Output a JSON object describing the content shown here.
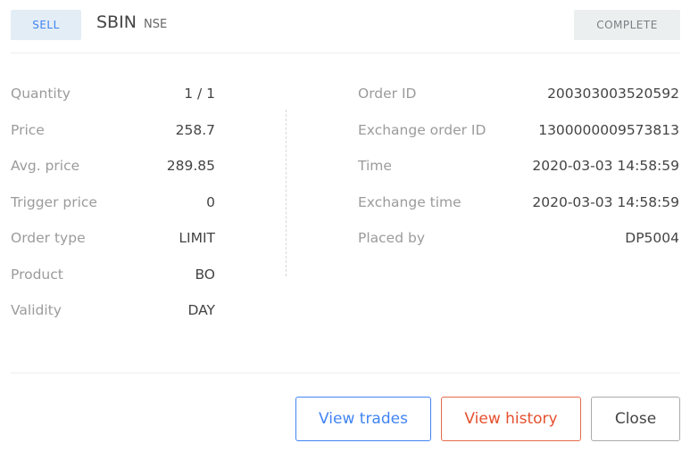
{
  "header": {
    "side": "SELL",
    "symbol": "SBIN",
    "exchange": "NSE",
    "status": "COMPLETE"
  },
  "details_left": [
    {
      "label": "Quantity",
      "value": "1 / 1"
    },
    {
      "label": "Price",
      "value": "258.7"
    },
    {
      "label": "Avg. price",
      "value": "289.85"
    },
    {
      "label": "Trigger price",
      "value": "0"
    },
    {
      "label": "Order type",
      "value": "LIMIT"
    },
    {
      "label": "Product",
      "value": "BO"
    },
    {
      "label": "Validity",
      "value": "DAY"
    }
  ],
  "details_right": [
    {
      "label": "Order ID",
      "value": "200303003520592"
    },
    {
      "label": "Exchange order ID",
      "value": "1300000009573813"
    },
    {
      "label": "Time",
      "value": "2020-03-03 14:58:59"
    },
    {
      "label": "Exchange time",
      "value": "2020-03-03 14:58:59"
    },
    {
      "label": "Placed by",
      "value": "DP5004"
    }
  ],
  "actions": {
    "view_trades": "View trades",
    "view_history": "View history",
    "close": "Close"
  },
  "colors": {
    "accent_blue": "#4184f3",
    "accent_red": "#e5502e",
    "sell_badge_bg": "#e3edf5",
    "status_badge_bg": "#eceff0"
  }
}
